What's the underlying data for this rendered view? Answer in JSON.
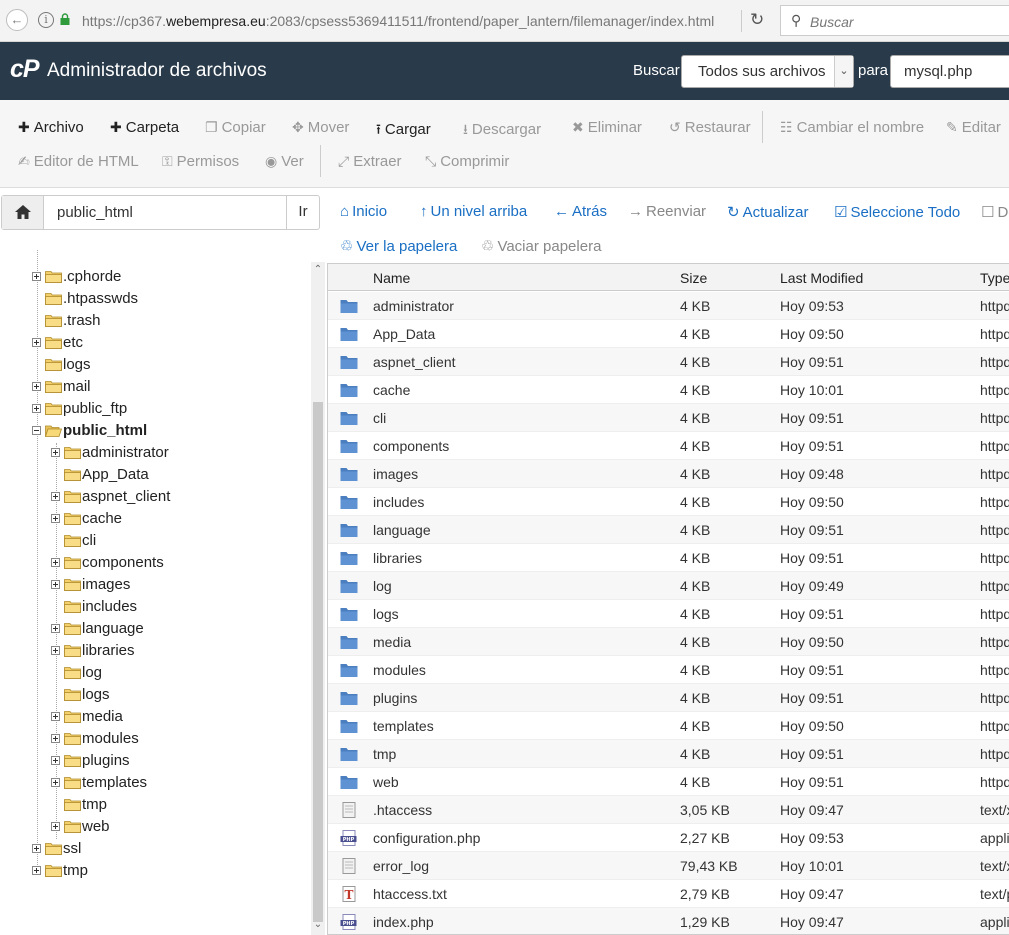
{
  "browser": {
    "url_prefix": "https://cp367.",
    "url_host": "webempresa.eu",
    "url_rest": ":2083/cpsess5369411511/frontend/paper_lantern/filemanager/index.html",
    "search_placeholder": "Buscar"
  },
  "header": {
    "logo": "cP",
    "title": "Administrador de archivos",
    "search_label": "Buscar",
    "search_scope": "Todos sus archivos",
    "for_label": "para",
    "search_value": "mysql.php"
  },
  "toolbar": {
    "row1": [
      {
        "label": "Archivo",
        "icon": "plus-icon",
        "enabled": true
      },
      {
        "label": "Carpeta",
        "icon": "plus-icon",
        "enabled": true
      },
      {
        "label": "Copiar",
        "icon": "copy-icon",
        "enabled": false
      },
      {
        "label": "Mover",
        "icon": "move-icon",
        "enabled": false
      },
      {
        "label": "Cargar",
        "icon": "upload-icon",
        "enabled": true
      },
      {
        "label": "Descargar",
        "icon": "download-icon",
        "enabled": false
      },
      {
        "label": "Eliminar",
        "icon": "close-icon",
        "enabled": false
      },
      {
        "label": "Restaurar",
        "icon": "undo-icon",
        "enabled": false
      },
      {
        "label": "Cambiar el nombre",
        "icon": "file-icon",
        "enabled": false
      },
      {
        "label": "Editar",
        "icon": "pencil-icon",
        "enabled": false
      }
    ],
    "row2": [
      {
        "label": "Editor de HTML",
        "icon": "edit-icon",
        "enabled": false
      },
      {
        "label": "Permisos",
        "icon": "key-icon",
        "enabled": false
      },
      {
        "label": "Ver",
        "icon": "eye-icon",
        "enabled": false
      },
      {
        "label": "Extraer",
        "icon": "expand-icon",
        "enabled": false
      },
      {
        "label": "Comprimir",
        "icon": "compress-icon",
        "enabled": false
      }
    ]
  },
  "pathbar": {
    "value": "public_html",
    "go_label": "Ir"
  },
  "nav": {
    "row1": [
      {
        "label": "Inicio",
        "icon": "home-icon",
        "enabled": true
      },
      {
        "label": "Un nivel arriba",
        "icon": "level-up-icon",
        "enabled": true
      },
      {
        "label": "Atrás",
        "icon": "arrow-left-icon",
        "enabled": true
      },
      {
        "label": "Reenviar",
        "icon": "arrow-right-icon",
        "enabled": false
      },
      {
        "label": "Actualizar",
        "icon": "refresh-icon",
        "enabled": true
      },
      {
        "label": "Seleccione Todo",
        "icon": "check-square-icon",
        "enabled": true
      },
      {
        "label": "De",
        "icon": "square-icon",
        "enabled": false
      }
    ],
    "row2": [
      {
        "label": "Ver la papelera",
        "icon": "trash-icon",
        "enabled": true
      },
      {
        "label": "Vaciar papelera",
        "icon": "trash-icon",
        "enabled": false
      }
    ]
  },
  "tree": [
    {
      "label": ".cphorde",
      "level": 1,
      "expander": "plus",
      "open": false,
      "bold": false
    },
    {
      "label": ".htpasswds",
      "level": 1,
      "expander": "none",
      "open": false,
      "bold": false
    },
    {
      "label": ".trash",
      "level": 1,
      "expander": "none",
      "open": false,
      "bold": false
    },
    {
      "label": "etc",
      "level": 1,
      "expander": "plus",
      "open": false,
      "bold": false
    },
    {
      "label": "logs",
      "level": 1,
      "expander": "none",
      "open": false,
      "bold": false
    },
    {
      "label": "mail",
      "level": 1,
      "expander": "plus",
      "open": false,
      "bold": false
    },
    {
      "label": "public_ftp",
      "level": 1,
      "expander": "plus",
      "open": false,
      "bold": false
    },
    {
      "label": "public_html",
      "level": 1,
      "expander": "minus",
      "open": true,
      "bold": true
    },
    {
      "label": "administrator",
      "level": 2,
      "expander": "plus",
      "open": false,
      "bold": false
    },
    {
      "label": "App_Data",
      "level": 2,
      "expander": "none",
      "open": false,
      "bold": false
    },
    {
      "label": "aspnet_client",
      "level": 2,
      "expander": "plus",
      "open": false,
      "bold": false
    },
    {
      "label": "cache",
      "level": 2,
      "expander": "plus",
      "open": false,
      "bold": false
    },
    {
      "label": "cli",
      "level": 2,
      "expander": "none",
      "open": false,
      "bold": false
    },
    {
      "label": "components",
      "level": 2,
      "expander": "plus",
      "open": false,
      "bold": false
    },
    {
      "label": "images",
      "level": 2,
      "expander": "plus",
      "open": false,
      "bold": false
    },
    {
      "label": "includes",
      "level": 2,
      "expander": "none",
      "open": false,
      "bold": false
    },
    {
      "label": "language",
      "level": 2,
      "expander": "plus",
      "open": false,
      "bold": false
    },
    {
      "label": "libraries",
      "level": 2,
      "expander": "plus",
      "open": false,
      "bold": false
    },
    {
      "label": "log",
      "level": 2,
      "expander": "none",
      "open": false,
      "bold": false
    },
    {
      "label": "logs",
      "level": 2,
      "expander": "none",
      "open": false,
      "bold": false
    },
    {
      "label": "media",
      "level": 2,
      "expander": "plus",
      "open": false,
      "bold": false
    },
    {
      "label": "modules",
      "level": 2,
      "expander": "plus",
      "open": false,
      "bold": false
    },
    {
      "label": "plugins",
      "level": 2,
      "expander": "plus",
      "open": false,
      "bold": false
    },
    {
      "label": "templates",
      "level": 2,
      "expander": "plus",
      "open": false,
      "bold": false
    },
    {
      "label": "tmp",
      "level": 2,
      "expander": "none",
      "open": false,
      "bold": false
    },
    {
      "label": "web",
      "level": 2,
      "expander": "plus",
      "open": false,
      "bold": false
    },
    {
      "label": "ssl",
      "level": 1,
      "expander": "plus",
      "open": false,
      "bold": false
    },
    {
      "label": "tmp",
      "level": 1,
      "expander": "plus",
      "open": false,
      "bold": false
    }
  ],
  "table": {
    "columns": [
      "Name",
      "Size",
      "Last Modified",
      "Type"
    ],
    "rows": [
      {
        "name": "administrator",
        "size": "4 KB",
        "modified": "Hoy 09:53",
        "type": "httpd/unix-directory",
        "icon": "folder-icon"
      },
      {
        "name": "App_Data",
        "size": "4 KB",
        "modified": "Hoy 09:50",
        "type": "httpd/unix-directory",
        "icon": "folder-icon"
      },
      {
        "name": "aspnet_client",
        "size": "4 KB",
        "modified": "Hoy 09:51",
        "type": "httpd/unix-directory",
        "icon": "folder-icon"
      },
      {
        "name": "cache",
        "size": "4 KB",
        "modified": "Hoy 10:01",
        "type": "httpd/unix-directory",
        "icon": "folder-icon"
      },
      {
        "name": "cli",
        "size": "4 KB",
        "modified": "Hoy 09:51",
        "type": "httpd/unix-directory",
        "icon": "folder-icon"
      },
      {
        "name": "components",
        "size": "4 KB",
        "modified": "Hoy 09:51",
        "type": "httpd/unix-directory",
        "icon": "folder-icon"
      },
      {
        "name": "images",
        "size": "4 KB",
        "modified": "Hoy 09:48",
        "type": "httpd/unix-directory",
        "icon": "folder-icon"
      },
      {
        "name": "includes",
        "size": "4 KB",
        "modified": "Hoy 09:50",
        "type": "httpd/unix-directory",
        "icon": "folder-icon"
      },
      {
        "name": "language",
        "size": "4 KB",
        "modified": "Hoy 09:51",
        "type": "httpd/unix-directory",
        "icon": "folder-icon"
      },
      {
        "name": "libraries",
        "size": "4 KB",
        "modified": "Hoy 09:51",
        "type": "httpd/unix-directory",
        "icon": "folder-icon"
      },
      {
        "name": "log",
        "size": "4 KB",
        "modified": "Hoy 09:49",
        "type": "httpd/unix-directory",
        "icon": "folder-icon"
      },
      {
        "name": "logs",
        "size": "4 KB",
        "modified": "Hoy 09:51",
        "type": "httpd/unix-directory",
        "icon": "folder-icon"
      },
      {
        "name": "media",
        "size": "4 KB",
        "modified": "Hoy 09:50",
        "type": "httpd/unix-directory",
        "icon": "folder-icon"
      },
      {
        "name": "modules",
        "size": "4 KB",
        "modified": "Hoy 09:51",
        "type": "httpd/unix-directory",
        "icon": "folder-icon"
      },
      {
        "name": "plugins",
        "size": "4 KB",
        "modified": "Hoy 09:51",
        "type": "httpd/unix-directory",
        "icon": "folder-icon"
      },
      {
        "name": "templates",
        "size": "4 KB",
        "modified": "Hoy 09:50",
        "type": "httpd/unix-directory",
        "icon": "folder-icon"
      },
      {
        "name": "tmp",
        "size": "4 KB",
        "modified": "Hoy 09:51",
        "type": "httpd/unix-directory",
        "icon": "folder-icon"
      },
      {
        "name": "web",
        "size": "4 KB",
        "modified": "Hoy 09:51",
        "type": "httpd/unix-directory",
        "icon": "folder-icon"
      },
      {
        "name": ".htaccess",
        "size": "3,05 KB",
        "modified": "Hoy 09:47",
        "type": "text/x-generic",
        "icon": "text-file-icon"
      },
      {
        "name": "configuration.php",
        "size": "2,27 KB",
        "modified": "Hoy 09:53",
        "type": "application/x-httpd-php",
        "icon": "php-file-icon"
      },
      {
        "name": "error_log",
        "size": "79,43 KB",
        "modified": "Hoy 10:01",
        "type": "text/x-generic",
        "icon": "text-file-icon"
      },
      {
        "name": "htaccess.txt",
        "size": "2,79 KB",
        "modified": "Hoy 09:47",
        "type": "text/plain",
        "icon": "txt-file-icon"
      },
      {
        "name": "index.php",
        "size": "1,29 KB",
        "modified": "Hoy 09:47",
        "type": "application/x-httpd-php",
        "icon": "php-file-icon"
      }
    ]
  },
  "colors": {
    "header_bg": "#293a4a",
    "link_blue": "#1a6fc4",
    "folder_blue": "#4b7fc0",
    "tree_folder_yellow": "#f4d06a"
  }
}
